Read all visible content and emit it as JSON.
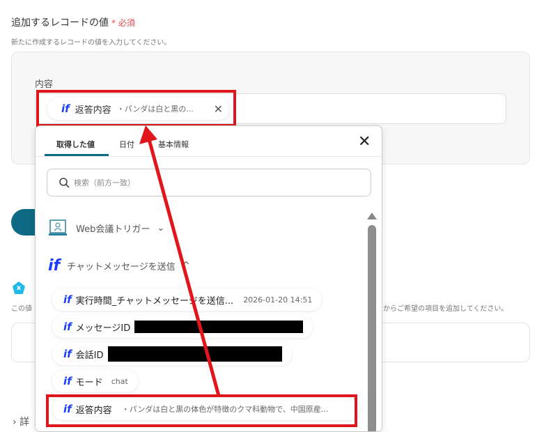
{
  "section": {
    "title": "追加するレコードの値",
    "required": "必須",
    "asterisk": "*",
    "description": "新たに作成するレコードの値を入力してください。"
  },
  "field": {
    "label": "内容",
    "chip": {
      "icon": "if",
      "name": "返答内容",
      "preview": "・パンダは白と黒の...",
      "remove": "✕"
    }
  },
  "background": {
    "hint_left": "この値",
    "hint_right": "からご希望の項目を追加してください。",
    "details": "詳",
    "x_badge": "x"
  },
  "dropdown": {
    "tabs": [
      {
        "label": "取得した値"
      },
      {
        "label": "日付"
      },
      {
        "label": "基本情報"
      }
    ],
    "close": "✕",
    "search_placeholder": "検索（前方一致）",
    "groups": [
      {
        "label": "Web会議トリガー",
        "chevron": "⌄"
      },
      {
        "icon": "if",
        "label": "チャットメッセージを送信",
        "chevron": "^"
      }
    ],
    "items": [
      {
        "icon": "if",
        "name": "実行時間_チャットメッセージを送信...",
        "value": "2026-01-20 14:51"
      },
      {
        "icon": "if",
        "name": "メッセージID",
        "value": ""
      },
      {
        "icon": "if",
        "name": "会話ID",
        "value": ""
      },
      {
        "icon": "if",
        "name": "モード",
        "value": "chat"
      },
      {
        "icon": "if",
        "name": "返答内容",
        "value": "・パンダは白と黒の体色が特徴のクマ科動物で、中国原産..."
      }
    ]
  },
  "colors": {
    "annotation": "#e0161c",
    "brand": "#1a3cff",
    "teal": "#0e6a84"
  }
}
